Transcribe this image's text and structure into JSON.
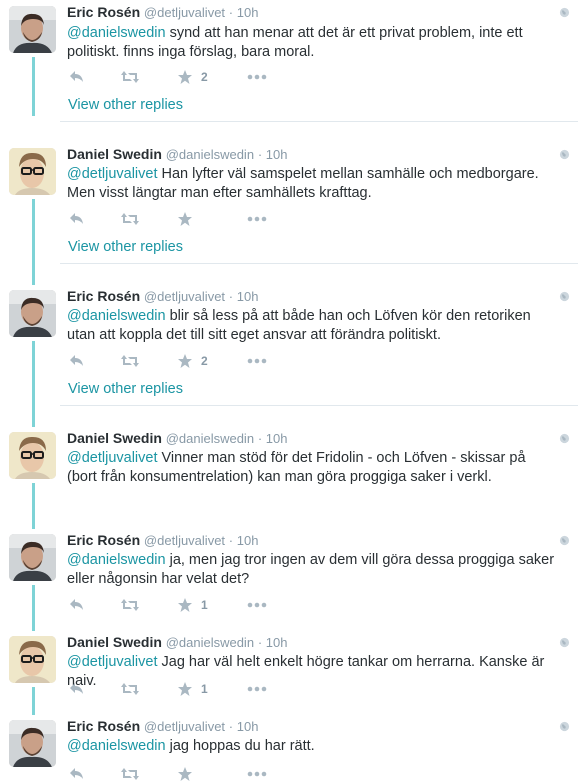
{
  "tweets": [
    {
      "author": "Eric Rosén",
      "handle": "@detljuvalivet",
      "time": "· 10h",
      "mention": "@danielswedin",
      "text": " synd att han menar att det är ett privat problem, inte ett politiskt. finns inga förslag, bara moral.",
      "favorites": "2",
      "view_replies": "View other replies"
    },
    {
      "author": "Daniel Swedin",
      "handle": "@danielswedin",
      "time": "· 10h",
      "mention": "@detljuvalivet",
      "text": " Han lyfter väl samspelet mellan samhälle och medborgare. Men visst längtar man efter samhällets krafttag.",
      "favorites": "",
      "view_replies": "View other replies"
    },
    {
      "author": "Eric Rosén",
      "handle": "@detljuvalivet",
      "time": "· 10h",
      "mention": "@danielswedin",
      "text": " blir så less på att både han och Löfven kör den retoriken utan att koppla det till sitt eget ansvar att förändra politiskt.",
      "favorites": "2",
      "view_replies": "View other replies"
    },
    {
      "author": "Daniel Swedin",
      "handle": "@danielswedin",
      "time": "· 10h",
      "mention": "@detljuvalivet",
      "text": " Vinner man stöd för det Fridolin - och Löfven - skissar på (bort från konsumentrelation) kan man göra proggiga saker i verkl.",
      "favorites": "",
      "view_replies": ""
    },
    {
      "author": "Eric Rosén",
      "handle": "@detljuvalivet",
      "time": "· 10h",
      "mention": "@danielswedin",
      "text": " ja, men jag tror ingen av dem vill göra dessa proggiga saker eller någonsin har velat det?",
      "favorites": "1",
      "view_replies": ""
    },
    {
      "author": "Daniel Swedin",
      "handle": "@danielswedin",
      "time": "· 10h",
      "mention": "@detljuvalivet",
      "text": " Jag har väl helt enkelt högre tankar om herrarna. Kanske är naiv.",
      "favorites": "1",
      "view_replies": ""
    },
    {
      "author": "Eric Rosén",
      "handle": "@detljuvalivet",
      "time": "· 10h",
      "mention": "@danielswedin",
      "text": " jag hoppas du har rätt.",
      "favorites": "",
      "view_replies": ""
    }
  ],
  "icons": {
    "reply": "reply-icon",
    "retweet": "retweet-icon",
    "favorite": "star-icon",
    "more": "more-icon",
    "globe": "globe-icon"
  },
  "colors": {
    "accent": "#1b95a3",
    "thread_line": "#7ed3d6",
    "muted": "#8899a6",
    "divider": "#e1e8ed"
  }
}
